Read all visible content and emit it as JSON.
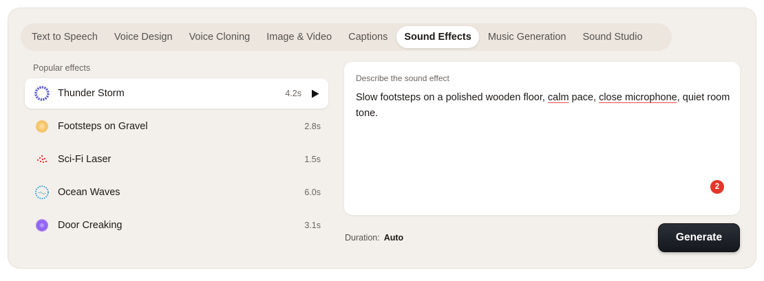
{
  "tabs": [
    {
      "label": "Text to Speech",
      "active": false
    },
    {
      "label": "Voice Design",
      "active": false
    },
    {
      "label": "Voice Cloning",
      "active": false
    },
    {
      "label": "Image & Video",
      "active": false
    },
    {
      "label": "Captions",
      "active": false
    },
    {
      "label": "Sound Effects",
      "active": true
    },
    {
      "label": "Music Generation",
      "active": false
    },
    {
      "label": "Sound Studio",
      "active": false
    }
  ],
  "effects_section": {
    "label": "Popular effects",
    "items": [
      {
        "name": "Thunder Storm",
        "duration": "4.2s",
        "icon": "thunder-storm-icon",
        "color": "#5b5bd6",
        "selected": true
      },
      {
        "name": "Footsteps on Gravel",
        "duration": "2.8s",
        "icon": "footsteps-icon",
        "color": "#f5a623",
        "selected": false
      },
      {
        "name": "Sci-Fi Laser",
        "duration": "1.5s",
        "icon": "laser-icon",
        "color": "#e5342a",
        "selected": false
      },
      {
        "name": "Ocean Waves",
        "duration": "6.0s",
        "icon": "ocean-waves-icon",
        "color": "#1e9bd7",
        "selected": false
      },
      {
        "name": "Door Creaking",
        "duration": "3.1s",
        "icon": "door-icon",
        "color": "#8b5cf6",
        "selected": false
      }
    ]
  },
  "prompt": {
    "label": "Describe the sound effect",
    "text_parts": [
      "Slow footsteps on a polished wooden floor, ",
      "calm",
      " pace, ",
      "close microphone",
      ", quiet room tone."
    ],
    "issue_count": "2"
  },
  "duration": {
    "label": "Duration:",
    "value": "Auto"
  },
  "generate_label": "Generate"
}
